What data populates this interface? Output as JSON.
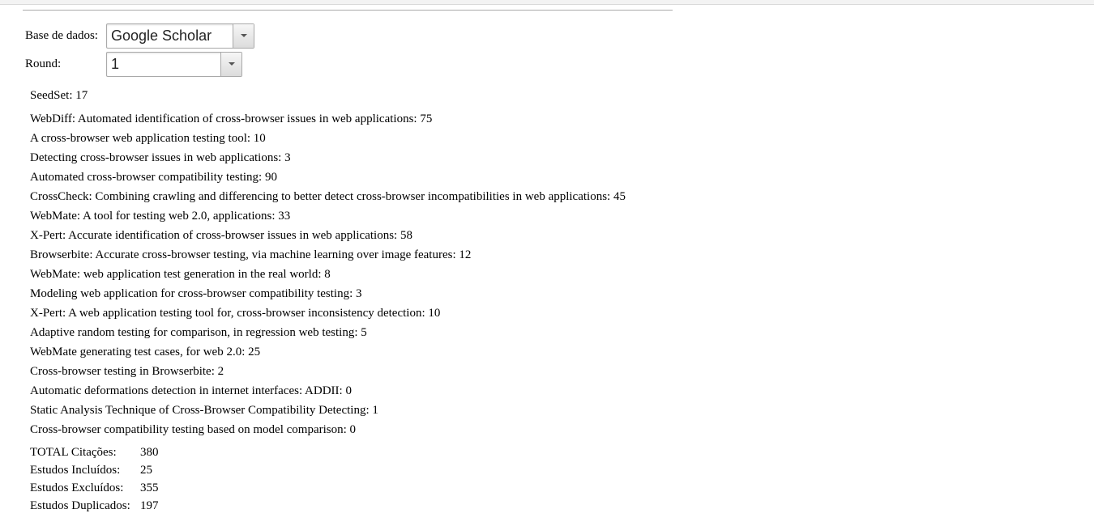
{
  "form": {
    "database_label": "Base de dados:",
    "database_value": "Google Scholar",
    "round_label": "Round:",
    "round_value": "1"
  },
  "seedset": {
    "label": "SeedSet:",
    "value": "17"
  },
  "studies": [
    "WebDiff: Automated identification of cross-browser issues in web applications: 75",
    "A cross-browser web application testing tool: 10",
    "Detecting cross-browser issues in web applications: 3",
    "Automated cross-browser compatibility testing: 90",
    "CrossCheck: Combining crawling and differencing to better detect cross-browser incompatibilities in web applications: 45",
    "WebMate: A tool for testing web 2.0, applications: 33",
    "X-Pert: Accurate identification of cross-browser issues in web applications: 58",
    "Browserbite: Accurate cross-browser testing, via machine learning over image features: 12",
    "WebMate: web application test generation in the real world: 8",
    "Modeling web application for cross-browser compatibility testing: 3",
    "X-Pert: A web application testing tool for, cross-browser inconsistency detection: 10",
    "Adaptive random testing for comparison, in regression web testing: 5",
    "WebMate generating test cases, for web 2.0: 25",
    "Cross-browser testing in Browserbite: 2",
    "Automatic deformations detection in internet interfaces: ADDII: 0",
    "Static Analysis Technique of Cross-Browser Compatibility Detecting: 1",
    "Cross-browser compatibility testing based on model comparison: 0"
  ],
  "totals": [
    {
      "label": "TOTAL Citações:",
      "value": "380"
    },
    {
      "label": "Estudos Incluídos:",
      "value": "25"
    },
    {
      "label": "Estudos Excluídos:",
      "value": "355"
    },
    {
      "label": "Estudos Duplicados:",
      "value": "197"
    }
  ]
}
